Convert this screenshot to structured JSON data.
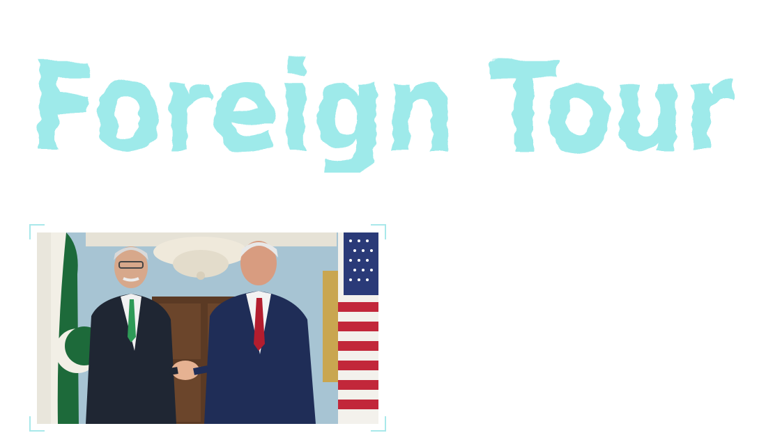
{
  "heading": {
    "text": "Foreign Tour",
    "color": "#9eeaea"
  },
  "photo": {
    "icon": "handshake-photo",
    "accent_color": "#a8e8ea"
  }
}
